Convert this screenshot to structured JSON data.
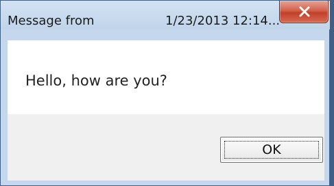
{
  "dialog": {
    "title": "Message from",
    "title_datetime": "1/23/2013 12:14...",
    "message": "Hello, how are you?",
    "ok_label": "OK",
    "close_icon": "close-x-icon"
  }
}
